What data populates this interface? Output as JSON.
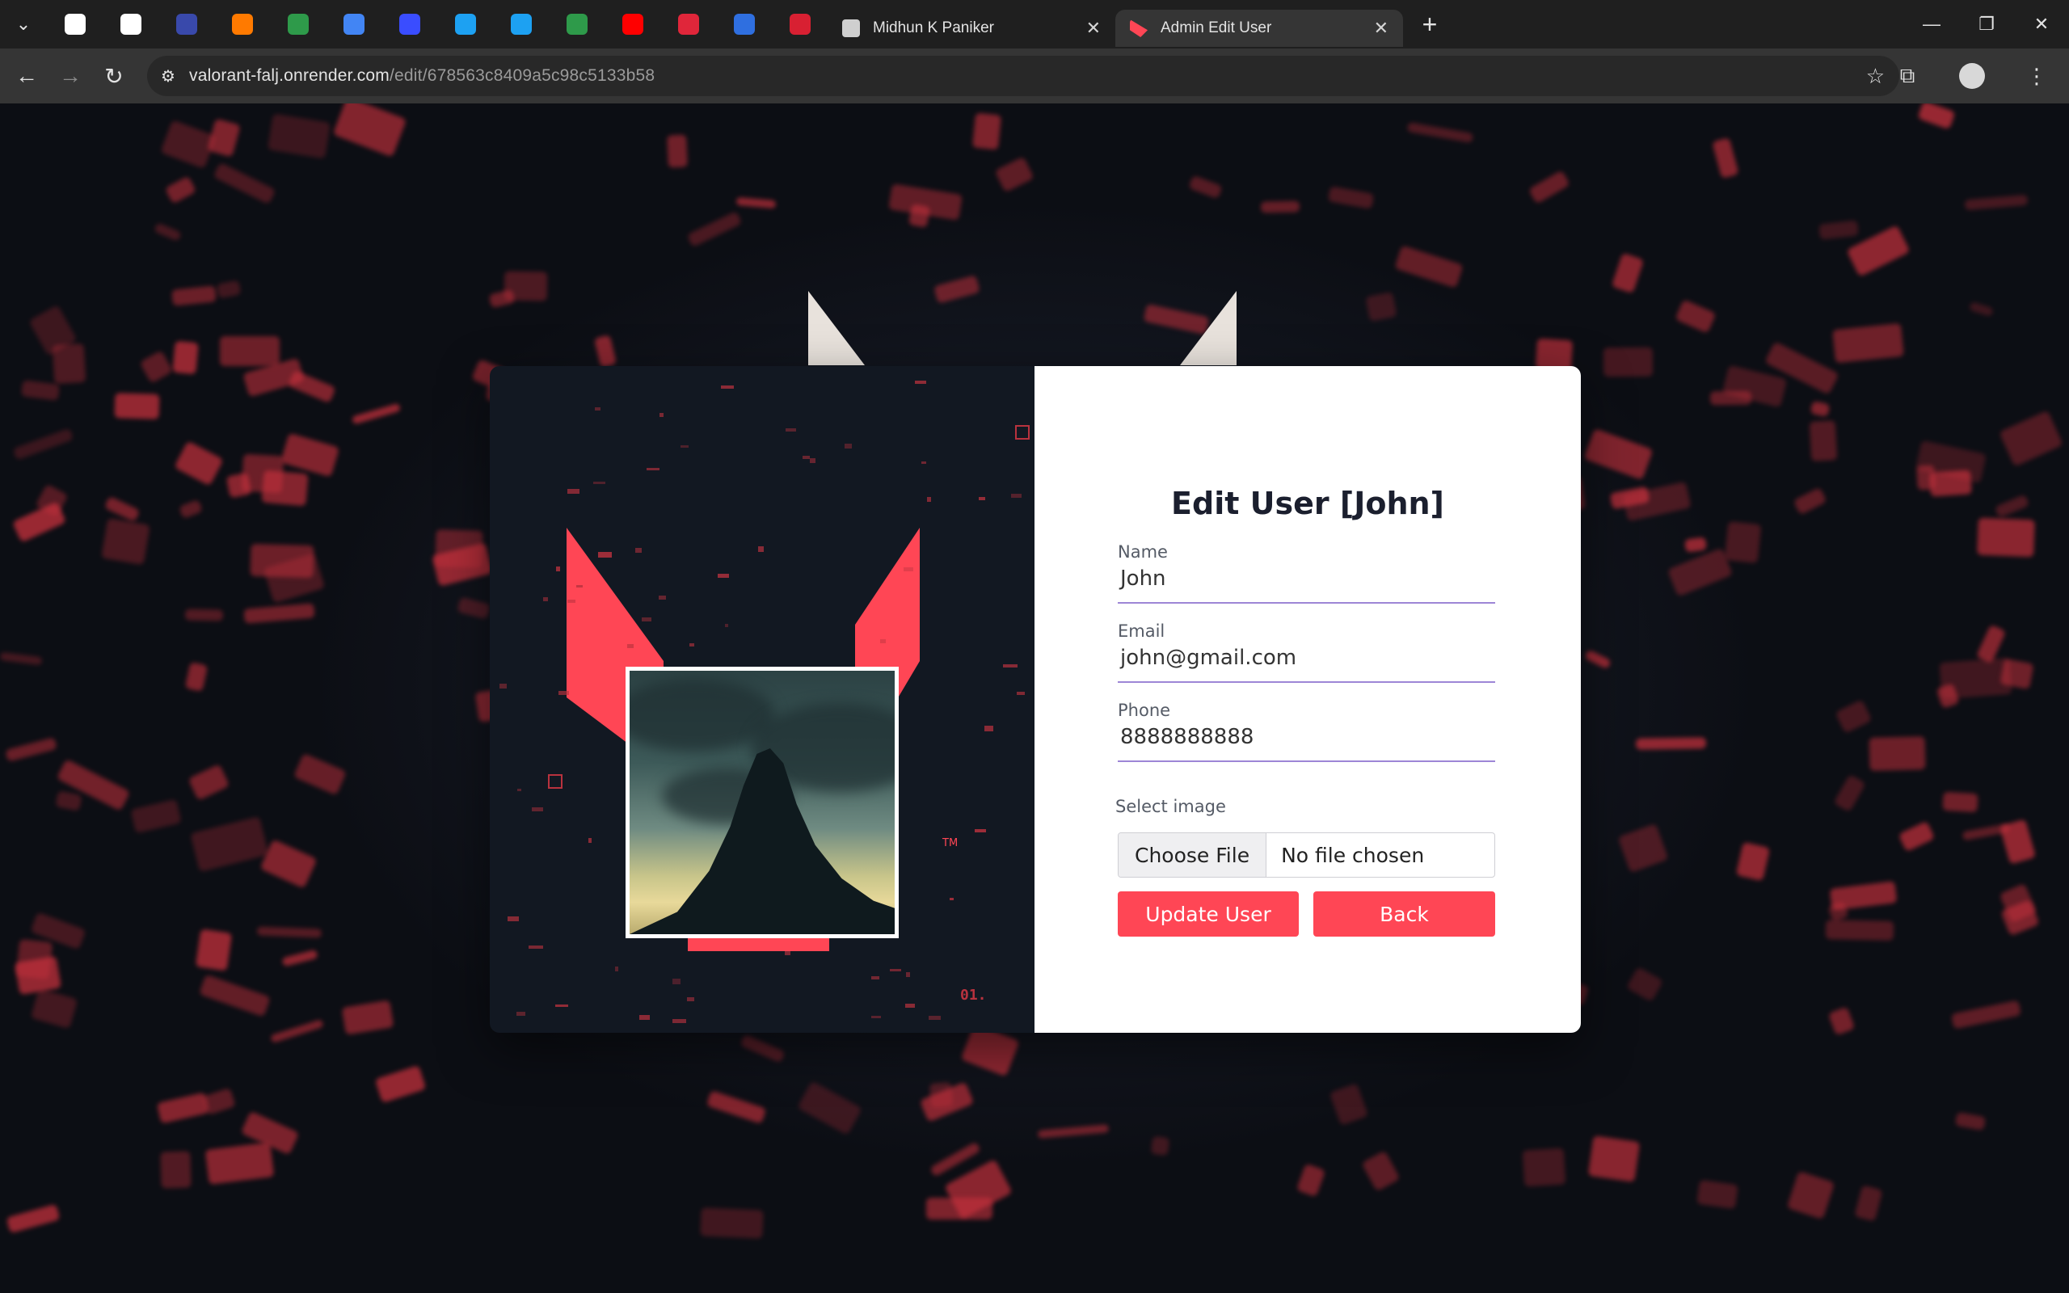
{
  "browser": {
    "pinned_tabs": [
      {
        "icon": "openai-icon",
        "color": "#ffffff"
      },
      {
        "icon": "app-icon",
        "color": "#ffffff"
      },
      {
        "icon": "dashboard-icon",
        "color": "#3949ab"
      },
      {
        "icon": "fire-icon",
        "color": "#ff7a00"
      },
      {
        "icon": "globe-icon",
        "color": "#2e9a4a"
      },
      {
        "icon": "docs-icon",
        "color": "#4285f4"
      },
      {
        "icon": "dots-icon",
        "color": "#3a4dff"
      },
      {
        "icon": "play-icon",
        "color": "#1da1f2"
      },
      {
        "icon": "play-icon",
        "color": "#1da1f2"
      },
      {
        "icon": "globe-icon",
        "color": "#2e9a4a"
      },
      {
        "icon": "youtube-icon",
        "color": "#ff0000"
      },
      {
        "icon": "bird-icon",
        "color": "#e0263a"
      },
      {
        "icon": "edge-icon",
        "color": "#2f6fe0"
      },
      {
        "icon": "m-logo-icon",
        "color": "#d82032"
      }
    ],
    "tabs": [
      {
        "title": "Midhun K Paniker",
        "close": "✕",
        "active": false
      },
      {
        "title": "Admin Edit User",
        "close": "✕",
        "active": true
      }
    ],
    "new_tab": "+",
    "url_host": "valorant-falj.onrender.com",
    "url_path": "/edit/678563c8409a5c98c5133b58"
  },
  "form": {
    "title": "Edit User [John]",
    "name_label": "Name",
    "name_value": "John",
    "email_label": "Email",
    "email_value": "john@gmail.com",
    "phone_label": "Phone",
    "phone_value": "8888888888",
    "image_label": "Select image",
    "choose_file": "Choose File",
    "file_status": "No file chosen",
    "update_button": "Update User",
    "back_button": "Back"
  },
  "hud": {
    "number": "01.",
    "tm": "TM"
  },
  "colors": {
    "accent": "#ff4655",
    "underline": "#9d86d6",
    "panel_dark": "#121822"
  }
}
